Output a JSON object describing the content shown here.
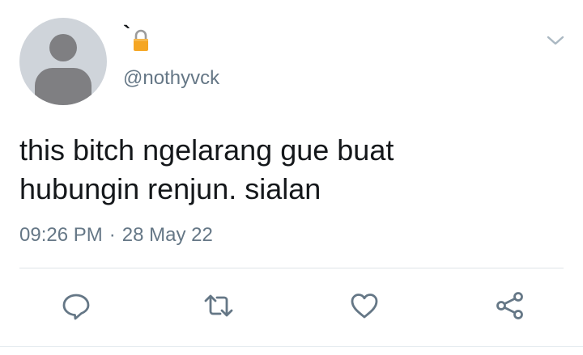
{
  "tweet": {
    "display_name": "`",
    "handle": "@nothyvck",
    "text_line1": "this bitch ngelarang gue buat",
    "text_line2": "hubungin renjun. sialan",
    "time": "09:26 PM",
    "separator": "·",
    "date": "28 May 22"
  },
  "icons": {
    "lock": "lock-icon",
    "caret": "chevron-down-icon",
    "reply": "reply-icon",
    "retweet": "retweet-icon",
    "like": "heart-icon",
    "share": "share-icon"
  },
  "colors": {
    "text": "#14171a",
    "secondary": "#657786",
    "icon": "#657786",
    "lock": "#f5a623",
    "avatar_bg": "#cfd4da",
    "avatar_fg": "#7f7f82"
  }
}
